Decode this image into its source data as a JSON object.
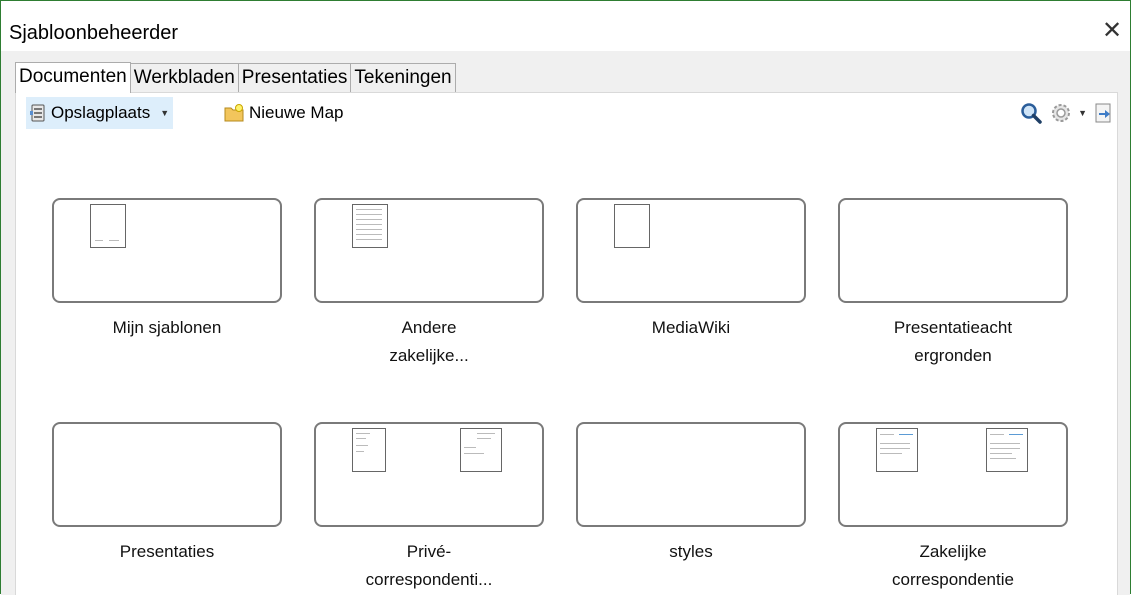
{
  "window": {
    "title": "Sjabloonbeheerder",
    "close_glyph": "✕"
  },
  "tabs": [
    {
      "label": "Documenten",
      "active": true
    },
    {
      "label": "Werkbladen",
      "active": false
    },
    {
      "label": "Presentaties",
      "active": false
    },
    {
      "label": "Tekeningen",
      "active": false
    }
  ],
  "toolbar": {
    "repository_label": "Opslagplaats",
    "new_folder_label": "Nieuwe Map",
    "icons": {
      "repository": "repository-icon",
      "new_folder": "new-folder-icon",
      "search": "search-icon",
      "settings": "gear-icon",
      "import": "import-icon"
    }
  },
  "folders": [
    {
      "name": "Mijn sjablonen",
      "line1": "Mijn sjablonen",
      "line2": "",
      "previews": 1
    },
    {
      "name": "Andere zakelijke...",
      "line1": "Andere",
      "line2": "zakelijke...",
      "previews": 1
    },
    {
      "name": "MediaWiki",
      "line1": "MediaWiki",
      "line2": "",
      "previews": 1
    },
    {
      "name": "Presentatieachtergronden",
      "line1": "Presentatieacht",
      "line2": "ergronden",
      "previews": 0
    },
    {
      "name": "Presentaties",
      "line1": "Presentaties",
      "line2": "",
      "previews": 0
    },
    {
      "name": "Privé-correspondenti...",
      "line1": "Privé-",
      "line2": "correspondenti...",
      "previews": 2
    },
    {
      "name": "styles",
      "line1": "styles",
      "line2": "",
      "previews": 0
    },
    {
      "name": "Zakelijke correspondentie",
      "line1": "Zakelijke",
      "line2": "correspondentie",
      "previews": 2
    }
  ],
  "colors": {
    "accent": "#2e7d32",
    "selected_bg": "#ddeefb",
    "tile_border": "#7a7a7a"
  }
}
